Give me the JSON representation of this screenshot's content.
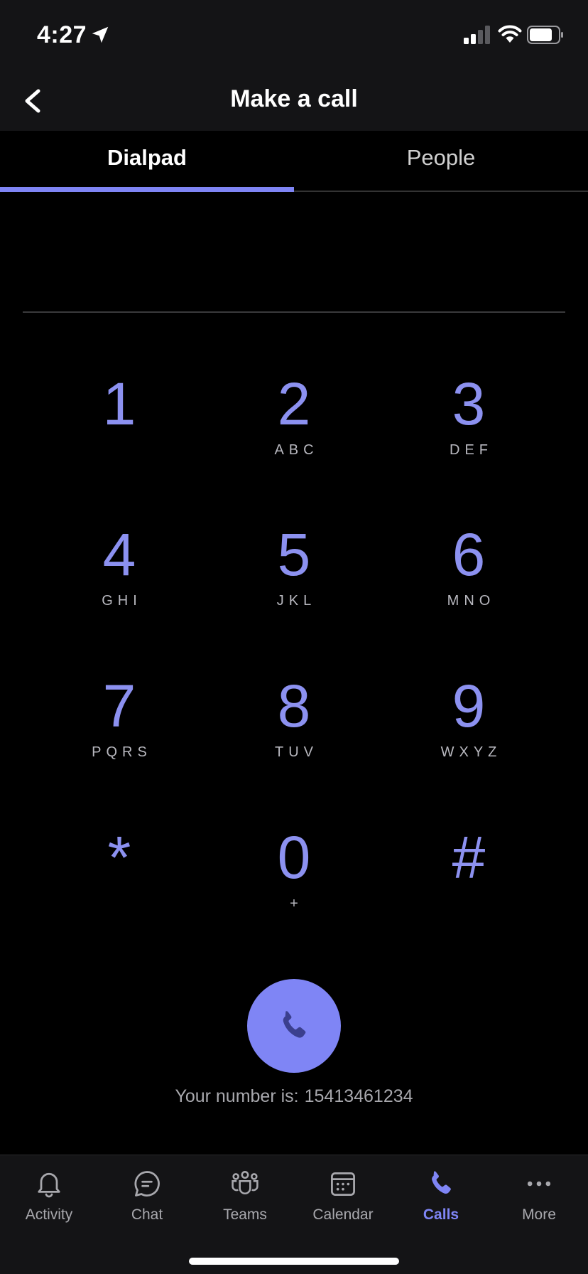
{
  "status_bar": {
    "time": "4:27"
  },
  "header": {
    "title": "Make a call"
  },
  "tabs": [
    {
      "label": "Dialpad",
      "active": true
    },
    {
      "label": "People",
      "active": false
    }
  ],
  "dial_input": {
    "value": "",
    "placeholder": ""
  },
  "keypad": [
    {
      "digit": "1",
      "letters": ""
    },
    {
      "digit": "2",
      "letters": "ABC"
    },
    {
      "digit": "3",
      "letters": "DEF"
    },
    {
      "digit": "4",
      "letters": "GHI"
    },
    {
      "digit": "5",
      "letters": "JKL"
    },
    {
      "digit": "6",
      "letters": "MNO"
    },
    {
      "digit": "7",
      "letters": "PQRS"
    },
    {
      "digit": "8",
      "letters": "TUV"
    },
    {
      "digit": "9",
      "letters": "WXYZ"
    },
    {
      "digit": "*",
      "letters": ""
    },
    {
      "digit": "0",
      "letters": "+"
    },
    {
      "digit": "#",
      "letters": ""
    }
  ],
  "call": {
    "your_number_label": "Your number is:",
    "your_number": "15413461234"
  },
  "bottom_nav": [
    {
      "label": "Activity",
      "icon": "bell-icon",
      "active": false
    },
    {
      "label": "Chat",
      "icon": "chat-icon",
      "active": false
    },
    {
      "label": "Teams",
      "icon": "teams-icon",
      "active": false
    },
    {
      "label": "Calendar",
      "icon": "calendar-icon",
      "active": false
    },
    {
      "label": "Calls",
      "icon": "phone-icon",
      "active": true
    },
    {
      "label": "More",
      "icon": "more-icon",
      "active": false
    }
  ],
  "colors": {
    "accent": "#7f85f5",
    "background": "#000000",
    "bar_background": "#141416",
    "secondary_text": "#a8a8ad"
  }
}
